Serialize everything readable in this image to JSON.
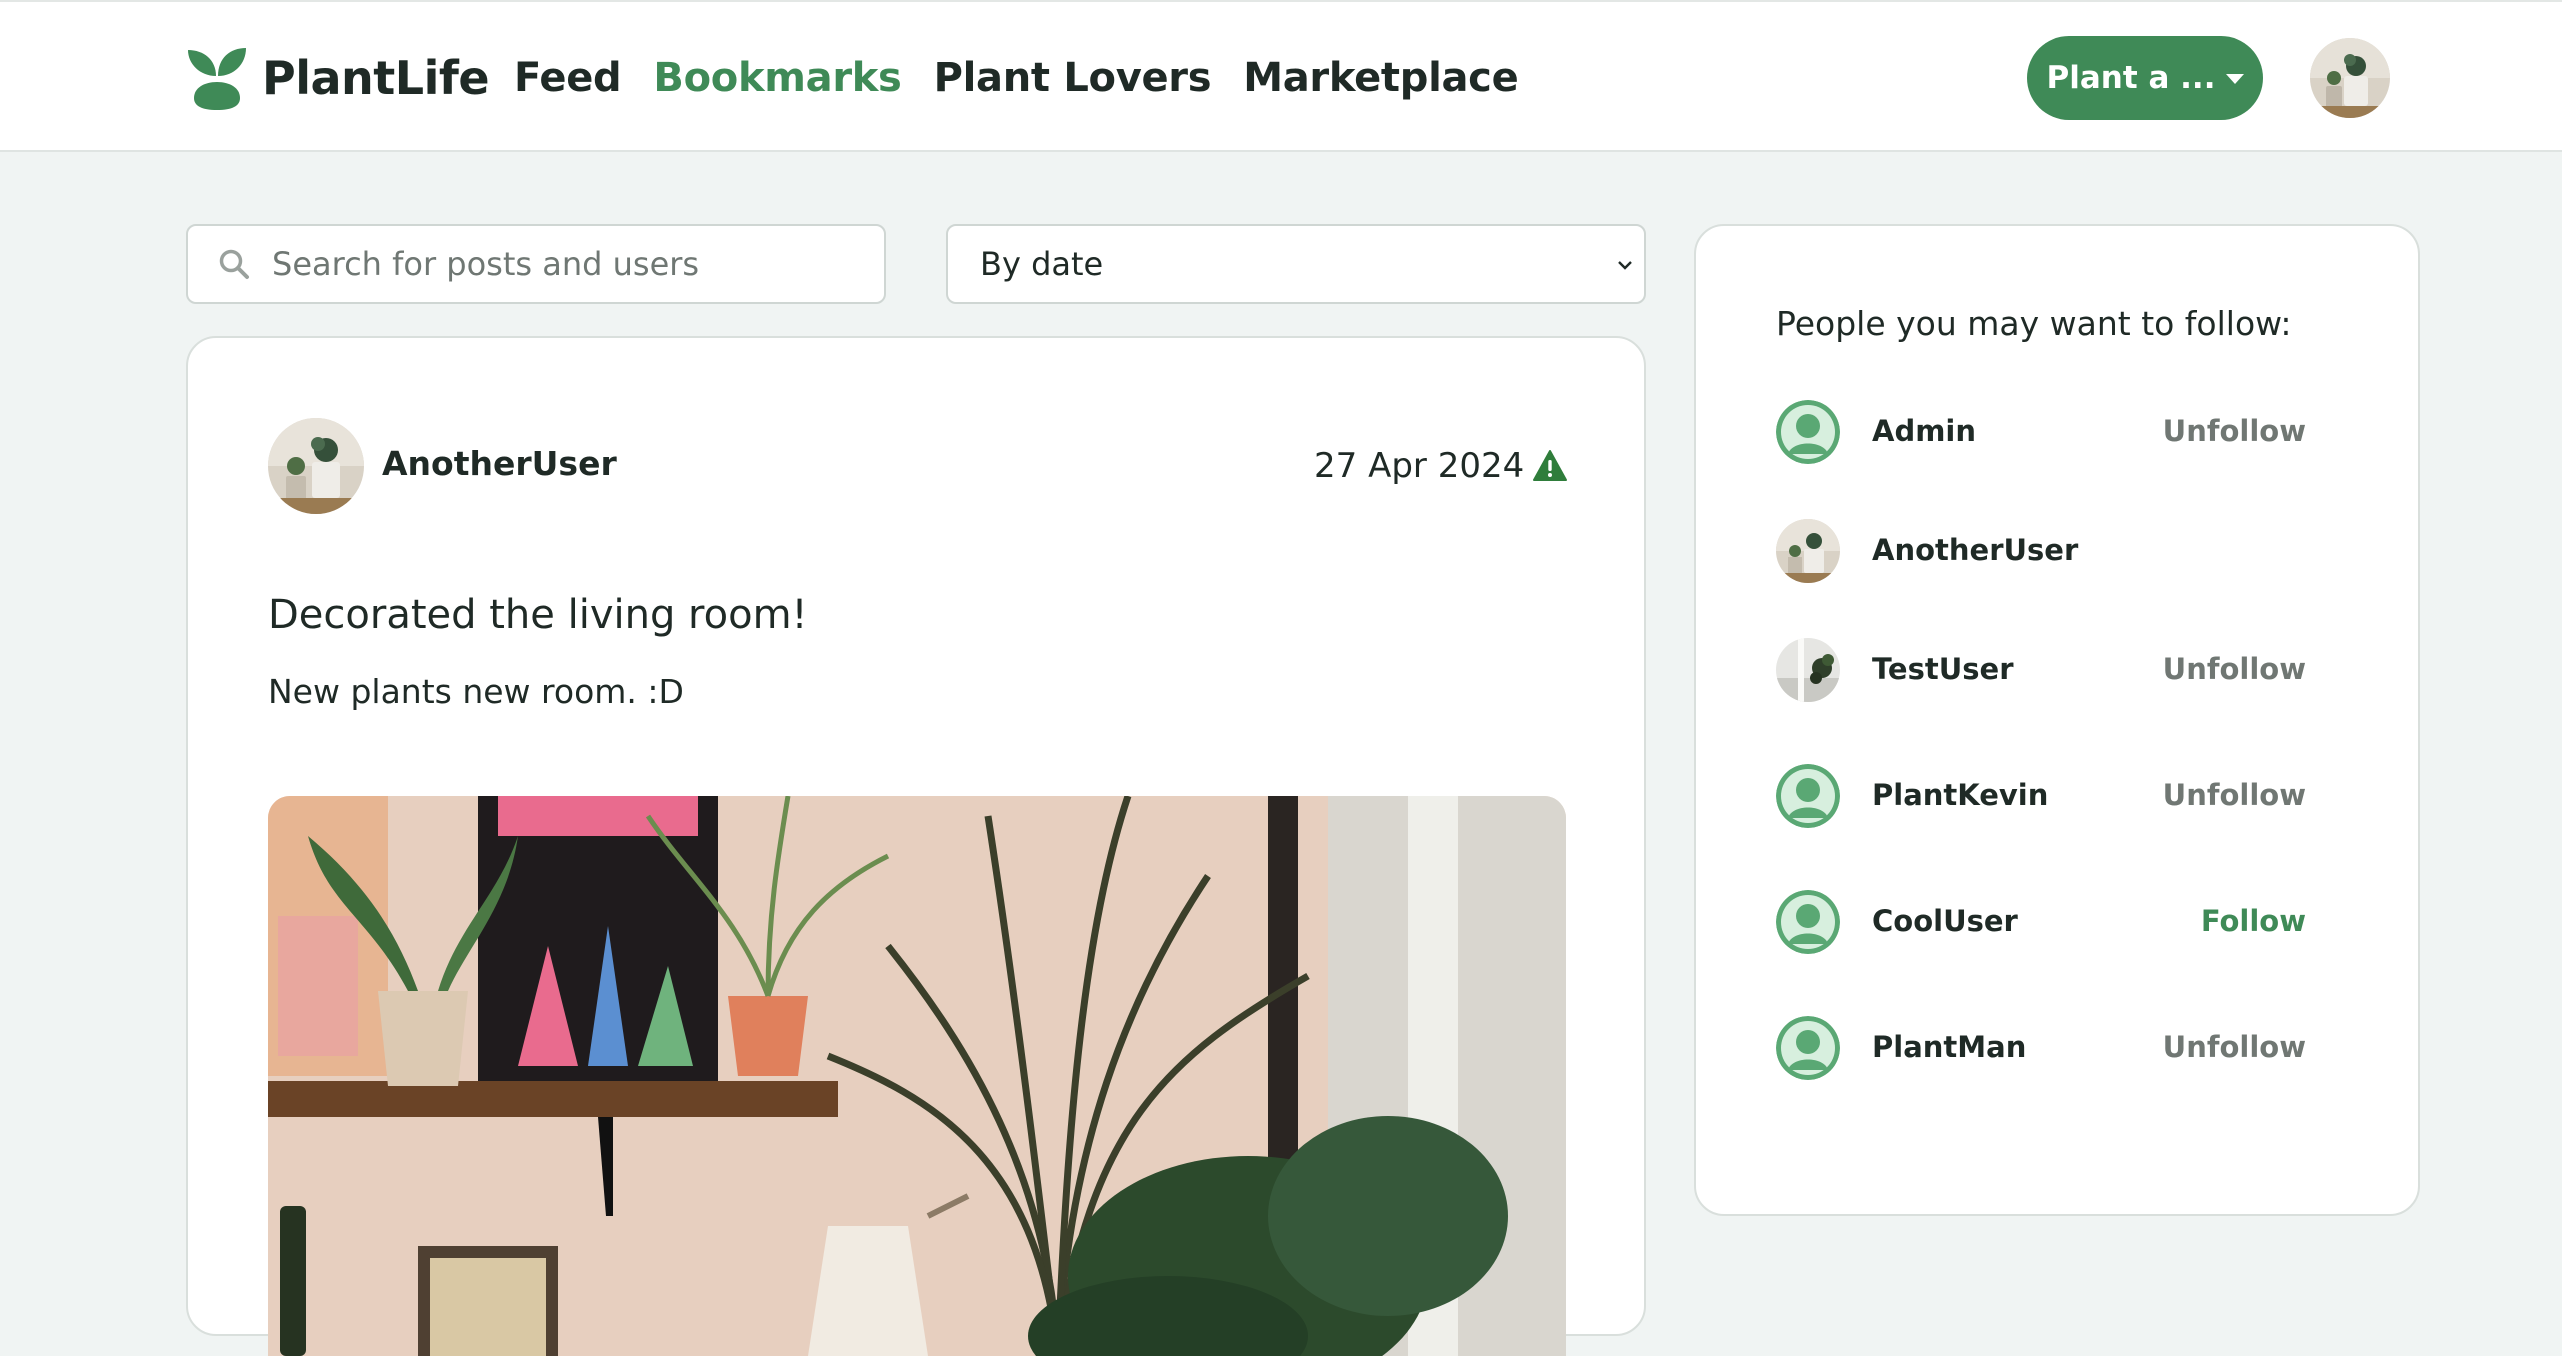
{
  "header": {
    "brand": "PlantLife",
    "nav": [
      {
        "label": "Feed",
        "active": false
      },
      {
        "label": "Bookmarks",
        "active": true
      },
      {
        "label": "Plant Lovers",
        "active": false
      },
      {
        "label": "Marketplace",
        "active": false
      }
    ],
    "plant_button": "Plant a ...",
    "avatar_icon": "user-avatar-plant-photo"
  },
  "search": {
    "placeholder": "Search for posts and users",
    "value": ""
  },
  "sort": {
    "selected": "By date"
  },
  "post": {
    "author": "AnotherUser",
    "date": "27 Apr 2024",
    "title": "Decorated the living room!",
    "body": "New plants new room. :D",
    "report_icon": "warning-triangle-icon"
  },
  "suggestions": {
    "heading": "People you may want to follow:",
    "users": [
      {
        "name": "Admin",
        "action": "Unfollow",
        "avatar": "default"
      },
      {
        "name": "AnotherUser",
        "action": "",
        "avatar": "photo"
      },
      {
        "name": "TestUser",
        "action": "Unfollow",
        "avatar": "photo2"
      },
      {
        "name": "PlantKevin",
        "action": "Unfollow",
        "avatar": "default"
      },
      {
        "name": "CoolUser",
        "action": "Follow",
        "avatar": "default"
      },
      {
        "name": "PlantMan",
        "action": "Unfollow",
        "avatar": "default"
      }
    ]
  },
  "colors": {
    "accent": "#3f8a57",
    "page_bg": "#f0f4f3",
    "muted_action": "#707773"
  }
}
